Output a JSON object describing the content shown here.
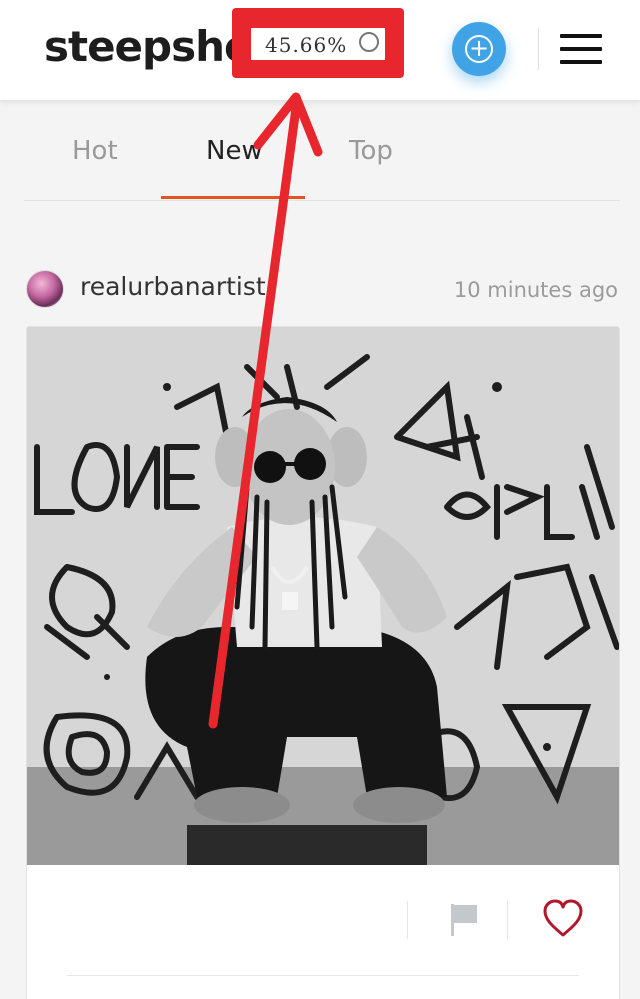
{
  "header": {
    "logo_text": "steepsho",
    "progress_text": "45.66%",
    "add_icon": "plus-circle-icon",
    "menu_icon": "hamburger-menu-icon"
  },
  "tabs": [
    {
      "label": "Hot",
      "active": false
    },
    {
      "label": "New",
      "active": true
    },
    {
      "label": "Top",
      "active": false
    }
  ],
  "post": {
    "author": "realurbanartist",
    "time": "10 minutes ago",
    "image_alt": "Black and white photo of a person with dreadlocks and round sunglasses crouching in front of a graffiti wall",
    "actions": {
      "flag_icon": "flag-icon",
      "like_icon": "heart-icon"
    }
  },
  "colors": {
    "accent": "#e5541f",
    "annotation": "#e8262d",
    "add_button": "#3fa3e6",
    "heart": "#b2182b"
  }
}
